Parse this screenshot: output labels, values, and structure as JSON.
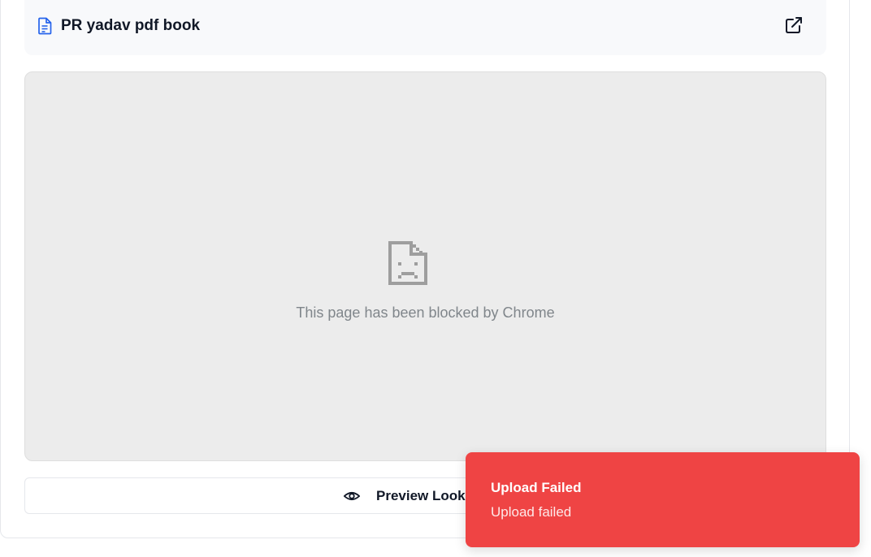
{
  "file": {
    "title": "PR yadav pdf book",
    "icon": "document-icon",
    "open_icon": "external-link-icon"
  },
  "preview": {
    "blocked_icon": "sad-page-icon",
    "blocked_message": "This page has been blocked by Chrome"
  },
  "preview_button": {
    "icon": "eye-icon",
    "label": "Preview Looks"
  },
  "toast": {
    "title": "Upload Failed",
    "message": "Upload failed",
    "color": "#ef4444"
  },
  "colors": {
    "accent_icon": "#2563eb",
    "frame_background": "#ececec",
    "blocked_gray": "#9e9e9e"
  }
}
